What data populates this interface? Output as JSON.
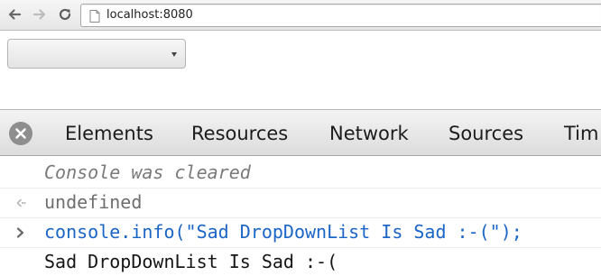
{
  "browser": {
    "url": "localhost:8080",
    "icons": {
      "back": "arrow-left-icon",
      "forward": "arrow-right-icon",
      "reload": "reload-icon",
      "page": "page-icon"
    }
  },
  "page": {
    "dropdown": {
      "selected": "",
      "icon": "chevron-down-icon"
    }
  },
  "devtools": {
    "tabs": [
      "Elements",
      "Resources",
      "Network",
      "Sources",
      "Tim"
    ],
    "close_icon": "close-icon"
  },
  "console": {
    "lines": [
      {
        "text": "Console was cleared",
        "kind": "system"
      },
      {
        "text": "undefined",
        "kind": "result",
        "icon": "result-arrow-icon"
      },
      {
        "text": "console.info(\"Sad DropDownList Is Sad :-(\");",
        "kind": "input",
        "icon": "prompt-chevron-icon"
      },
      {
        "text": "Sad DropDownList Is Sad :-(",
        "kind": "log"
      }
    ]
  },
  "colors": {
    "input_text": "#1b65c6",
    "muted_text": "#7a7a7a",
    "close_button": "#8e8e8e"
  }
}
